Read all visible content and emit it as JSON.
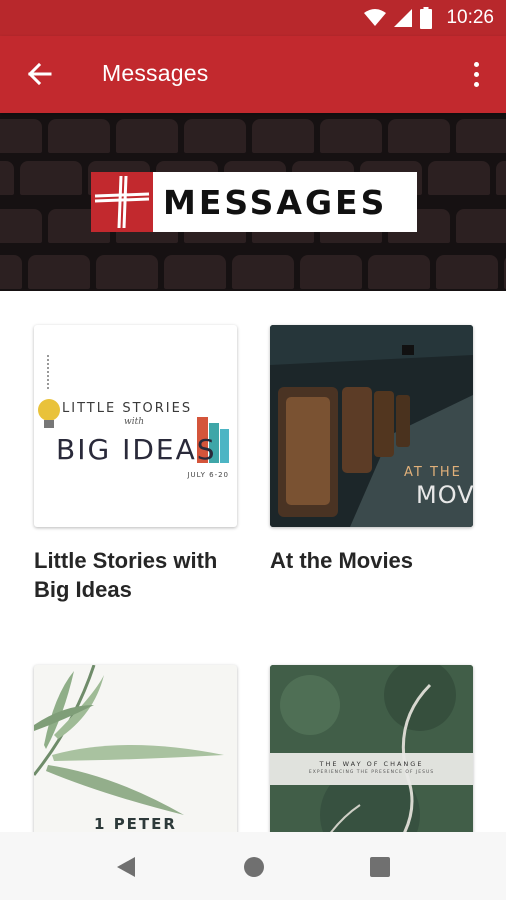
{
  "status_bar": {
    "time": "10:26",
    "icons": [
      "wifi-icon",
      "signal-icon",
      "battery-icon"
    ]
  },
  "app_bar": {
    "title": "Messages",
    "back_icon": "arrow-left-icon",
    "more_icon": "more-vertical-icon"
  },
  "banner": {
    "logo_text": "MESSAGES"
  },
  "cards": [
    {
      "title": "Little Stories with Big Ideas",
      "art": {
        "line1": "LITTLE STORIES",
        "line2": "with",
        "line3": "BIG IDEAS",
        "date": "JULY 6-20"
      }
    },
    {
      "title": "At the Movies",
      "art": {
        "line1": "AT THE",
        "line2": "MOV"
      }
    },
    {
      "title": "",
      "art": {
        "line1": "1 PETER"
      }
    },
    {
      "title": "",
      "art": {
        "line1": "THE WAY OF CHANGE",
        "line2": "EXPERIENCING THE PRESENCE OF JESUS"
      }
    }
  ],
  "nav_bar": {
    "back": "triangle-back-icon",
    "home": "circle-home-icon",
    "recents": "square-recents-icon"
  },
  "colors": {
    "primary": "#c2292e",
    "status_bar": "#b8282c",
    "banner_bg": "#161112"
  }
}
